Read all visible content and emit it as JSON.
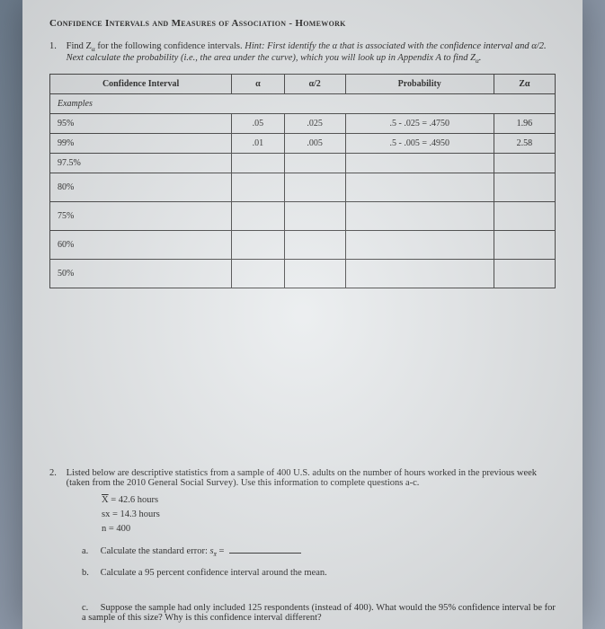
{
  "title": "Confidence Intervals and Measures of Association - Homework",
  "q1": {
    "number": "1.",
    "lead": "Find Z",
    "lead2": " for the following confidence intervals. ",
    "hint": "Hint: First identify the α that is associated with the confidence interval and α/2. Next calculate the probability (i.e., the area under the curve), which you will look up in Appendix A to find Z",
    "hint_sub": "α",
    "hint_end": "."
  },
  "table": {
    "headers": [
      "Confidence Interval",
      "α",
      "α/2",
      "Probability",
      "Zα"
    ],
    "examples_label": "Examples",
    "rows": [
      {
        "ci": "95%",
        "a": ".05",
        "a2": ".025",
        "p": ".5 - .025 = .4750",
        "z": "1.96"
      },
      {
        "ci": "99%",
        "a": ".01",
        "a2": ".005",
        "p": ".5 - .005 = .4950",
        "z": "2.58"
      },
      {
        "ci": "97.5%",
        "a": "",
        "a2": "",
        "p": "",
        "z": ""
      },
      {
        "ci": "80%",
        "a": "",
        "a2": "",
        "p": "",
        "z": ""
      },
      {
        "ci": "75%",
        "a": "",
        "a2": "",
        "p": "",
        "z": ""
      },
      {
        "ci": "60%",
        "a": "",
        "a2": "",
        "p": "",
        "z": ""
      },
      {
        "ci": "50%",
        "a": "",
        "a2": "",
        "p": "",
        "z": ""
      }
    ]
  },
  "q2": {
    "number": "2.",
    "text": "Listed below are descriptive statistics from a sample of 400 U.S. adults on the number of hours worked in the previous week (taken from the 2010 General Social Survey). Use this information to complete questions a-c.",
    "stats": {
      "xbar": "X = 42.6 hours",
      "sx": "sx = 14.3 hours",
      "n": "n = 400"
    },
    "a": {
      "letter": "a.",
      "text": "Calculate the standard error: ",
      "sym": "s",
      "sub": "x̄",
      "eq": " = "
    },
    "b": {
      "letter": "b.",
      "text": "Calculate a 95 percent confidence interval around the mean."
    },
    "c": {
      "letter": "c.",
      "text": "Suppose the sample had only included 125 respondents (instead of 400). What would the 95% confidence interval be for a sample of this size? Why is this confidence interval different?"
    }
  }
}
